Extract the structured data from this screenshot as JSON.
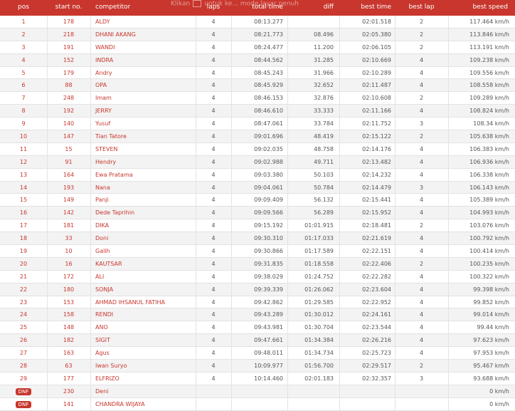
{
  "colors": {
    "header": "#c8362d",
    "link": "#c8362d"
  },
  "header": {
    "pos": "pos",
    "start_no": "start no.",
    "competitor": "competitor",
    "laps": "laps",
    "total_time": "total time",
    "diff": "diff",
    "best_time": "best time",
    "best_lap": "best lap",
    "best_speed": "best speed",
    "faded_prefix": "Klikan",
    "faded_text": "untuk ke... mode layar penuh"
  },
  "rows": [
    {
      "pos": "1",
      "start": "178",
      "name": "ALDY",
      "laps": "4",
      "total": "08:13.277",
      "diff": "",
      "best": "02:01.518",
      "lap": "2",
      "speed": "117.464 km/h"
    },
    {
      "pos": "2",
      "start": "218",
      "name": "DHANI AKANG",
      "laps": "4",
      "total": "08:21.773",
      "diff": "08.496",
      "best": "02:05.380",
      "lap": "2",
      "speed": "113.846 km/h"
    },
    {
      "pos": "3",
      "start": "191",
      "name": "WANDI",
      "laps": "4",
      "total": "08:24.477",
      "diff": "11.200",
      "best": "02:06.105",
      "lap": "2",
      "speed": "113.191 km/h"
    },
    {
      "pos": "4",
      "start": "152",
      "name": "INDRA",
      "laps": "4",
      "total": "08:44.562",
      "diff": "31.285",
      "best": "02:10.669",
      "lap": "4",
      "speed": "109.238 km/h"
    },
    {
      "pos": "5",
      "start": "179",
      "name": "Andry",
      "laps": "4",
      "total": "08:45.243",
      "diff": "31.966",
      "best": "02:10.289",
      "lap": "4",
      "speed": "109.556 km/h"
    },
    {
      "pos": "6",
      "start": "88",
      "name": "OPA",
      "laps": "4",
      "total": "08:45.929",
      "diff": "32.652",
      "best": "02:11.487",
      "lap": "4",
      "speed": "108.558 km/h"
    },
    {
      "pos": "7",
      "start": "248",
      "name": "Imam",
      "laps": "4",
      "total": "08:46.153",
      "diff": "32.876",
      "best": "02:10.608",
      "lap": "2",
      "speed": "109.289 km/h"
    },
    {
      "pos": "8",
      "start": "192",
      "name": "JERRY",
      "laps": "4",
      "total": "08:46.610",
      "diff": "33.333",
      "best": "02:11.166",
      "lap": "4",
      "speed": "108.824 km/h"
    },
    {
      "pos": "9",
      "start": "140",
      "name": "Yusuf",
      "laps": "4",
      "total": "08:47.061",
      "diff": "33.784",
      "best": "02:11.752",
      "lap": "3",
      "speed": "108.34 km/h"
    },
    {
      "pos": "10",
      "start": "147",
      "name": "Tian Tatore",
      "laps": "4",
      "total": "09:01.696",
      "diff": "48.419",
      "best": "02:15.122",
      "lap": "2",
      "speed": "105.638 km/h"
    },
    {
      "pos": "11",
      "start": "15",
      "name": "STEVEN",
      "laps": "4",
      "total": "09:02.035",
      "diff": "48.758",
      "best": "02:14.176",
      "lap": "4",
      "speed": "106.383 km/h"
    },
    {
      "pos": "12",
      "start": "91",
      "name": "Hendry",
      "laps": "4",
      "total": "09:02.988",
      "diff": "49.711",
      "best": "02:13.482",
      "lap": "4",
      "speed": "106.936 km/h"
    },
    {
      "pos": "13",
      "start": "164",
      "name": "Ewa Pratama",
      "laps": "4",
      "total": "09:03.380",
      "diff": "50.103",
      "best": "02:14.232",
      "lap": "4",
      "speed": "106.338 km/h"
    },
    {
      "pos": "14",
      "start": "193",
      "name": "Nana",
      "laps": "4",
      "total": "09:04.061",
      "diff": "50.784",
      "best": "02:14.479",
      "lap": "3",
      "speed": "106.143 km/h"
    },
    {
      "pos": "15",
      "start": "149",
      "name": "Panji",
      "laps": "4",
      "total": "09:09.409",
      "diff": "56.132",
      "best": "02:15.441",
      "lap": "4",
      "speed": "105.389 km/h"
    },
    {
      "pos": "16",
      "start": "142",
      "name": "Dede Taprihin",
      "laps": "4",
      "total": "09:09.566",
      "diff": "56.289",
      "best": "02:15.952",
      "lap": "4",
      "speed": "104.993 km/h"
    },
    {
      "pos": "17",
      "start": "181",
      "name": "DIKA",
      "laps": "4",
      "total": "09:15.192",
      "diff": "01:01.915",
      "best": "02:18.481",
      "lap": "2",
      "speed": "103.076 km/h"
    },
    {
      "pos": "18",
      "start": "33",
      "name": "Doni",
      "laps": "4",
      "total": "09:30.310",
      "diff": "01:17.033",
      "best": "02:21.619",
      "lap": "4",
      "speed": "100.792 km/h"
    },
    {
      "pos": "19",
      "start": "10",
      "name": "Galih",
      "laps": "4",
      "total": "09:30.866",
      "diff": "01:17.589",
      "best": "02:22.151",
      "lap": "4",
      "speed": "100.414 km/h"
    },
    {
      "pos": "20",
      "start": "16",
      "name": "KAUTSAR",
      "laps": "4",
      "total": "09:31.835",
      "diff": "01:18.558",
      "best": "02:22.406",
      "lap": "2",
      "speed": "100.235 km/h"
    },
    {
      "pos": "21",
      "start": "172",
      "name": "ALI",
      "laps": "4",
      "total": "09:38.029",
      "diff": "01:24.752",
      "best": "02:22.282",
      "lap": "4",
      "speed": "100.322 km/h"
    },
    {
      "pos": "22",
      "start": "180",
      "name": "SONJA",
      "laps": "4",
      "total": "09:39.339",
      "diff": "01:26.062",
      "best": "02:23.604",
      "lap": "4",
      "speed": "99.398 km/h"
    },
    {
      "pos": "23",
      "start": "153",
      "name": "AHMAD IHSANUL FATIHA",
      "laps": "4",
      "total": "09:42.862",
      "diff": "01:29.585",
      "best": "02:22.952",
      "lap": "4",
      "speed": "99.852 km/h"
    },
    {
      "pos": "24",
      "start": "158",
      "name": "RENDI",
      "laps": "4",
      "total": "09:43.289",
      "diff": "01:30.012",
      "best": "02:24.161",
      "lap": "4",
      "speed": "99.014 km/h"
    },
    {
      "pos": "25",
      "start": "148",
      "name": "ANO",
      "laps": "4",
      "total": "09:43.981",
      "diff": "01:30.704",
      "best": "02:23.544",
      "lap": "4",
      "speed": "99.44 km/h"
    },
    {
      "pos": "26",
      "start": "182",
      "name": "SIGIT",
      "laps": "4",
      "total": "09:47.661",
      "diff": "01:34.384",
      "best": "02:26.216",
      "lap": "4",
      "speed": "97.623 km/h"
    },
    {
      "pos": "27",
      "start": "163",
      "name": "Agus",
      "laps": "4",
      "total": "09:48.011",
      "diff": "01:34.734",
      "best": "02:25.723",
      "lap": "4",
      "speed": "97.953 km/h"
    },
    {
      "pos": "28",
      "start": "63",
      "name": "Iwan Suryo",
      "laps": "4",
      "total": "10:09.977",
      "diff": "01:56.700",
      "best": "02:29.517",
      "lap": "2",
      "speed": "95.467 km/h"
    },
    {
      "pos": "29",
      "start": "177",
      "name": "ELFRIZO",
      "laps": "4",
      "total": "10:14.460",
      "diff": "02:01.183",
      "best": "02:32.357",
      "lap": "3",
      "speed": "93.688 km/h"
    },
    {
      "pos": "DNF",
      "start": "230",
      "name": "Deni",
      "laps": "",
      "total": "",
      "diff": "",
      "best": "",
      "lap": "",
      "speed": "0 km/h",
      "dnf": true
    },
    {
      "pos": "DNF",
      "start": "141",
      "name": "CHANDRA WIJAYA",
      "laps": "",
      "total": "",
      "diff": "",
      "best": "",
      "lap": "",
      "speed": "0 km/h",
      "dnf": true
    }
  ]
}
